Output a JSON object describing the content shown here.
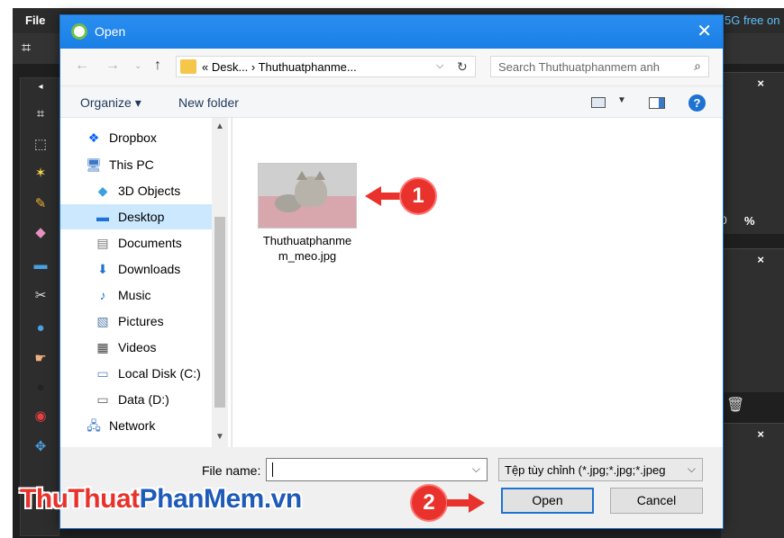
{
  "editor": {
    "menu_file": "File",
    "storage_note": "5G free on",
    "percent_sign": "%",
    "zero_value": "0",
    "close_symbol": "×",
    "toolbox_collapse": "◂"
  },
  "dialog": {
    "title": "Open",
    "close_symbol": "✕",
    "address": {
      "crumbs": "« Desk...  ›  Thuthuatphanme...",
      "chevron": "⌵",
      "refresh": "↻"
    },
    "search": {
      "placeholder": "Search Thuthuatphanmem anh"
    },
    "commands": {
      "organize": "Organize ▾",
      "new_folder": "New folder",
      "help": "?"
    },
    "nav_items": [
      {
        "label": "Dropbox",
        "icon": "dropbox-icon",
        "glyph": "❖",
        "color": "#0061fe"
      },
      {
        "label": "This PC",
        "icon": "computer-icon",
        "glyph": "🖥",
        "color": "#3a78c8"
      },
      {
        "label": "3D Objects",
        "icon": "cube-icon",
        "glyph": "◆",
        "color": "#3aa0e0"
      },
      {
        "label": "Desktop",
        "icon": "desktop-icon",
        "glyph": "▬",
        "color": "#1e73d2",
        "selected": true
      },
      {
        "label": "Documents",
        "icon": "document-icon",
        "glyph": "▤",
        "color": "#777777"
      },
      {
        "label": "Downloads",
        "icon": "download-icon",
        "glyph": "⬇",
        "color": "#1e73d2"
      },
      {
        "label": "Music",
        "icon": "music-icon",
        "glyph": "♪",
        "color": "#1e73d2"
      },
      {
        "label": "Pictures",
        "icon": "pictures-icon",
        "glyph": "▧",
        "color": "#5a7fa8"
      },
      {
        "label": "Videos",
        "icon": "videos-icon",
        "glyph": "▦",
        "color": "#444444"
      },
      {
        "label": "Local Disk (C:)",
        "icon": "disk-icon",
        "glyph": "▭",
        "color": "#5c86c2"
      },
      {
        "label": "Data (D:)",
        "icon": "drive-icon",
        "glyph": "▭",
        "color": "#666666"
      },
      {
        "label": "Network",
        "icon": "network-icon",
        "glyph": "🖧",
        "color": "#3a78c8"
      }
    ],
    "file": {
      "name": "Thuthuatphanmem_meo.jpg",
      "line1": "Thuthuatphanme",
      "line2": "m_meo.jpg"
    },
    "bottom": {
      "file_name_label": "File name:",
      "file_name_value": "",
      "filter": "Tệp tùy chỉnh (*.jpg;*.jpg;*.jpeg",
      "open_label": "Open",
      "cancel_label": "Cancel"
    }
  },
  "annotations": {
    "step1": "1",
    "step2": "2"
  },
  "watermark": {
    "part1": "ThuThuat",
    "part2": "PhanMem.vn"
  },
  "colors": {
    "titlebar": "#1a7fe6",
    "accent": "#1e73d2",
    "callout": "#e8322b"
  }
}
